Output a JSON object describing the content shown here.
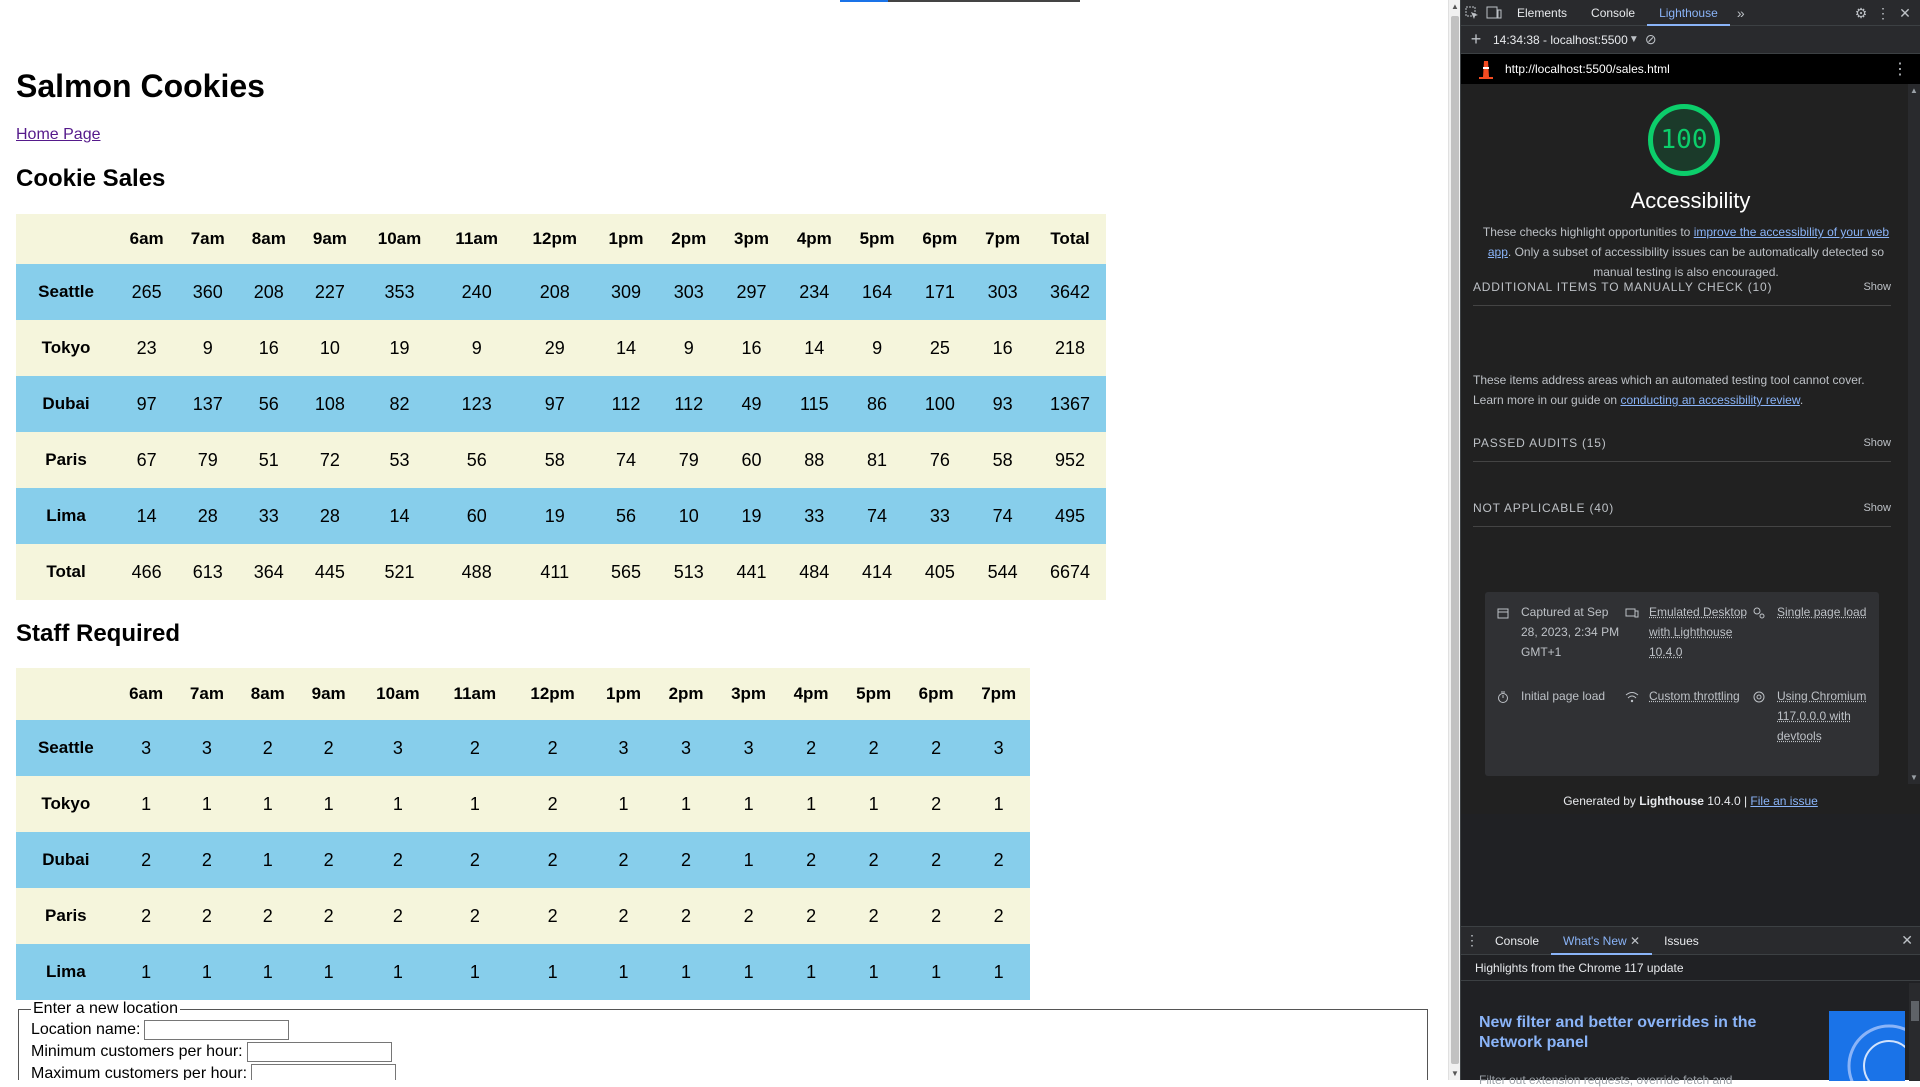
{
  "page": {
    "title": "Salmon Cookies",
    "home_link": "Home Page",
    "sales_heading": "Cookie Sales",
    "staff_heading": "Staff Required",
    "sales_table": {
      "headers": [
        "",
        "6am",
        "7am",
        "8am",
        "9am",
        "10am",
        "11am",
        "12pm",
        "1pm",
        "2pm",
        "3pm",
        "4pm",
        "5pm",
        "6pm",
        "7pm",
        "Total"
      ],
      "rows": [
        {
          "name": "Seattle",
          "values": [
            "265",
            "360",
            "208",
            "227",
            "353",
            "240",
            "208",
            "309",
            "303",
            "297",
            "234",
            "164",
            "171",
            "303",
            "3642"
          ]
        },
        {
          "name": "Tokyo",
          "values": [
            "23",
            "9",
            "16",
            "10",
            "19",
            "9",
            "29",
            "14",
            "9",
            "16",
            "14",
            "9",
            "25",
            "16",
            "218"
          ]
        },
        {
          "name": "Dubai",
          "values": [
            "97",
            "137",
            "56",
            "108",
            "82",
            "123",
            "97",
            "112",
            "112",
            "49",
            "115",
            "86",
            "100",
            "93",
            "1367"
          ]
        },
        {
          "name": "Paris",
          "values": [
            "67",
            "79",
            "51",
            "72",
            "53",
            "56",
            "58",
            "74",
            "79",
            "60",
            "88",
            "81",
            "76",
            "58",
            "952"
          ]
        },
        {
          "name": "Lima",
          "values": [
            "14",
            "28",
            "33",
            "28",
            "14",
            "60",
            "19",
            "56",
            "10",
            "19",
            "33",
            "74",
            "33",
            "74",
            "495"
          ]
        },
        {
          "name": "Total",
          "values": [
            "466",
            "613",
            "364",
            "445",
            "521",
            "488",
            "411",
            "565",
            "513",
            "441",
            "484",
            "414",
            "405",
            "544",
            "6674"
          ]
        }
      ]
    },
    "staff_table": {
      "headers": [
        "",
        "6am",
        "7am",
        "8am",
        "9am",
        "10am",
        "11am",
        "12pm",
        "1pm",
        "2pm",
        "3pm",
        "4pm",
        "5pm",
        "6pm",
        "7pm"
      ],
      "rows": [
        {
          "name": "Seattle",
          "values": [
            "3",
            "3",
            "2",
            "2",
            "3",
            "2",
            "2",
            "3",
            "3",
            "3",
            "2",
            "2",
            "2",
            "3"
          ]
        },
        {
          "name": "Tokyo",
          "values": [
            "1",
            "1",
            "1",
            "1",
            "1",
            "1",
            "2",
            "1",
            "1",
            "1",
            "1",
            "1",
            "2",
            "1"
          ]
        },
        {
          "name": "Dubai",
          "values": [
            "2",
            "2",
            "1",
            "2",
            "2",
            "2",
            "2",
            "2",
            "2",
            "1",
            "2",
            "2",
            "2",
            "2"
          ]
        },
        {
          "name": "Paris",
          "values": [
            "2",
            "2",
            "2",
            "2",
            "2",
            "2",
            "2",
            "2",
            "2",
            "2",
            "2",
            "2",
            "2",
            "2"
          ]
        },
        {
          "name": "Lima",
          "values": [
            "1",
            "1",
            "1",
            "1",
            "1",
            "1",
            "1",
            "1",
            "1",
            "1",
            "1",
            "1",
            "1",
            "1"
          ]
        }
      ]
    },
    "form": {
      "legend": "Enter a new location",
      "location_label": "Location name:",
      "min_label": "Minimum customers per hour:",
      "max_label": "Maximum customers per hour:"
    },
    "colors": {
      "row_beige": "#f5f5dc",
      "row_blue": "#87ceeb"
    }
  },
  "devtools": {
    "tabs": [
      "Elements",
      "Console",
      "Lighthouse"
    ],
    "active_tab": "Lighthouse",
    "report_selector": "14:34:38 - localhost:5500",
    "report_url": "http://localhost:5500/sales.html",
    "score": "100",
    "category_title": "Accessibility",
    "description_prefix": "These checks highlight opportunities to ",
    "description_link": "improve the accessibility of your web app",
    "description_suffix": ". Only a subset of accessibility issues can be automatically detected so manual testing is also encouraged.",
    "groups": {
      "manual": "ADDITIONAL ITEMS TO MANUALLY CHECK (10)",
      "passed": "PASSED AUDITS (15)",
      "na": "NOT APPLICABLE (40)",
      "show": "Show"
    },
    "manual_desc_prefix": "These items address areas which an automated testing tool cannot cover. Learn more in our guide on ",
    "manual_desc_link": "conducting an accessibility review",
    "manual_desc_suffix": ".",
    "meta": {
      "captured": "Captured at Sep 28, 2023, 2:34 PM GMT+1",
      "emulated": "Emulated Desktop with Lighthouse 10.4.0",
      "single": "Single page load",
      "initial": "Initial page load",
      "throttling": "Custom throttling",
      "chromium": "Using Chromium 117.0.0.0 with devtools"
    },
    "footer_prefix": "Generated by ",
    "footer_brand": "Lighthouse",
    "footer_version": " 10.4.0 | ",
    "footer_link": "File an issue",
    "drawer": {
      "tabs": [
        "Console",
        "What's New",
        "Issues"
      ],
      "active_tab": "What's New",
      "highlights": "Highlights from the Chrome 117 update",
      "article_title": "New filter and better overrides in the Network panel",
      "article_sub": "Filter out extension requests, override fetch and"
    },
    "colors": {
      "score_green": "#0cce6b",
      "link": "#8ab4f8",
      "bg": "#202124"
    }
  }
}
